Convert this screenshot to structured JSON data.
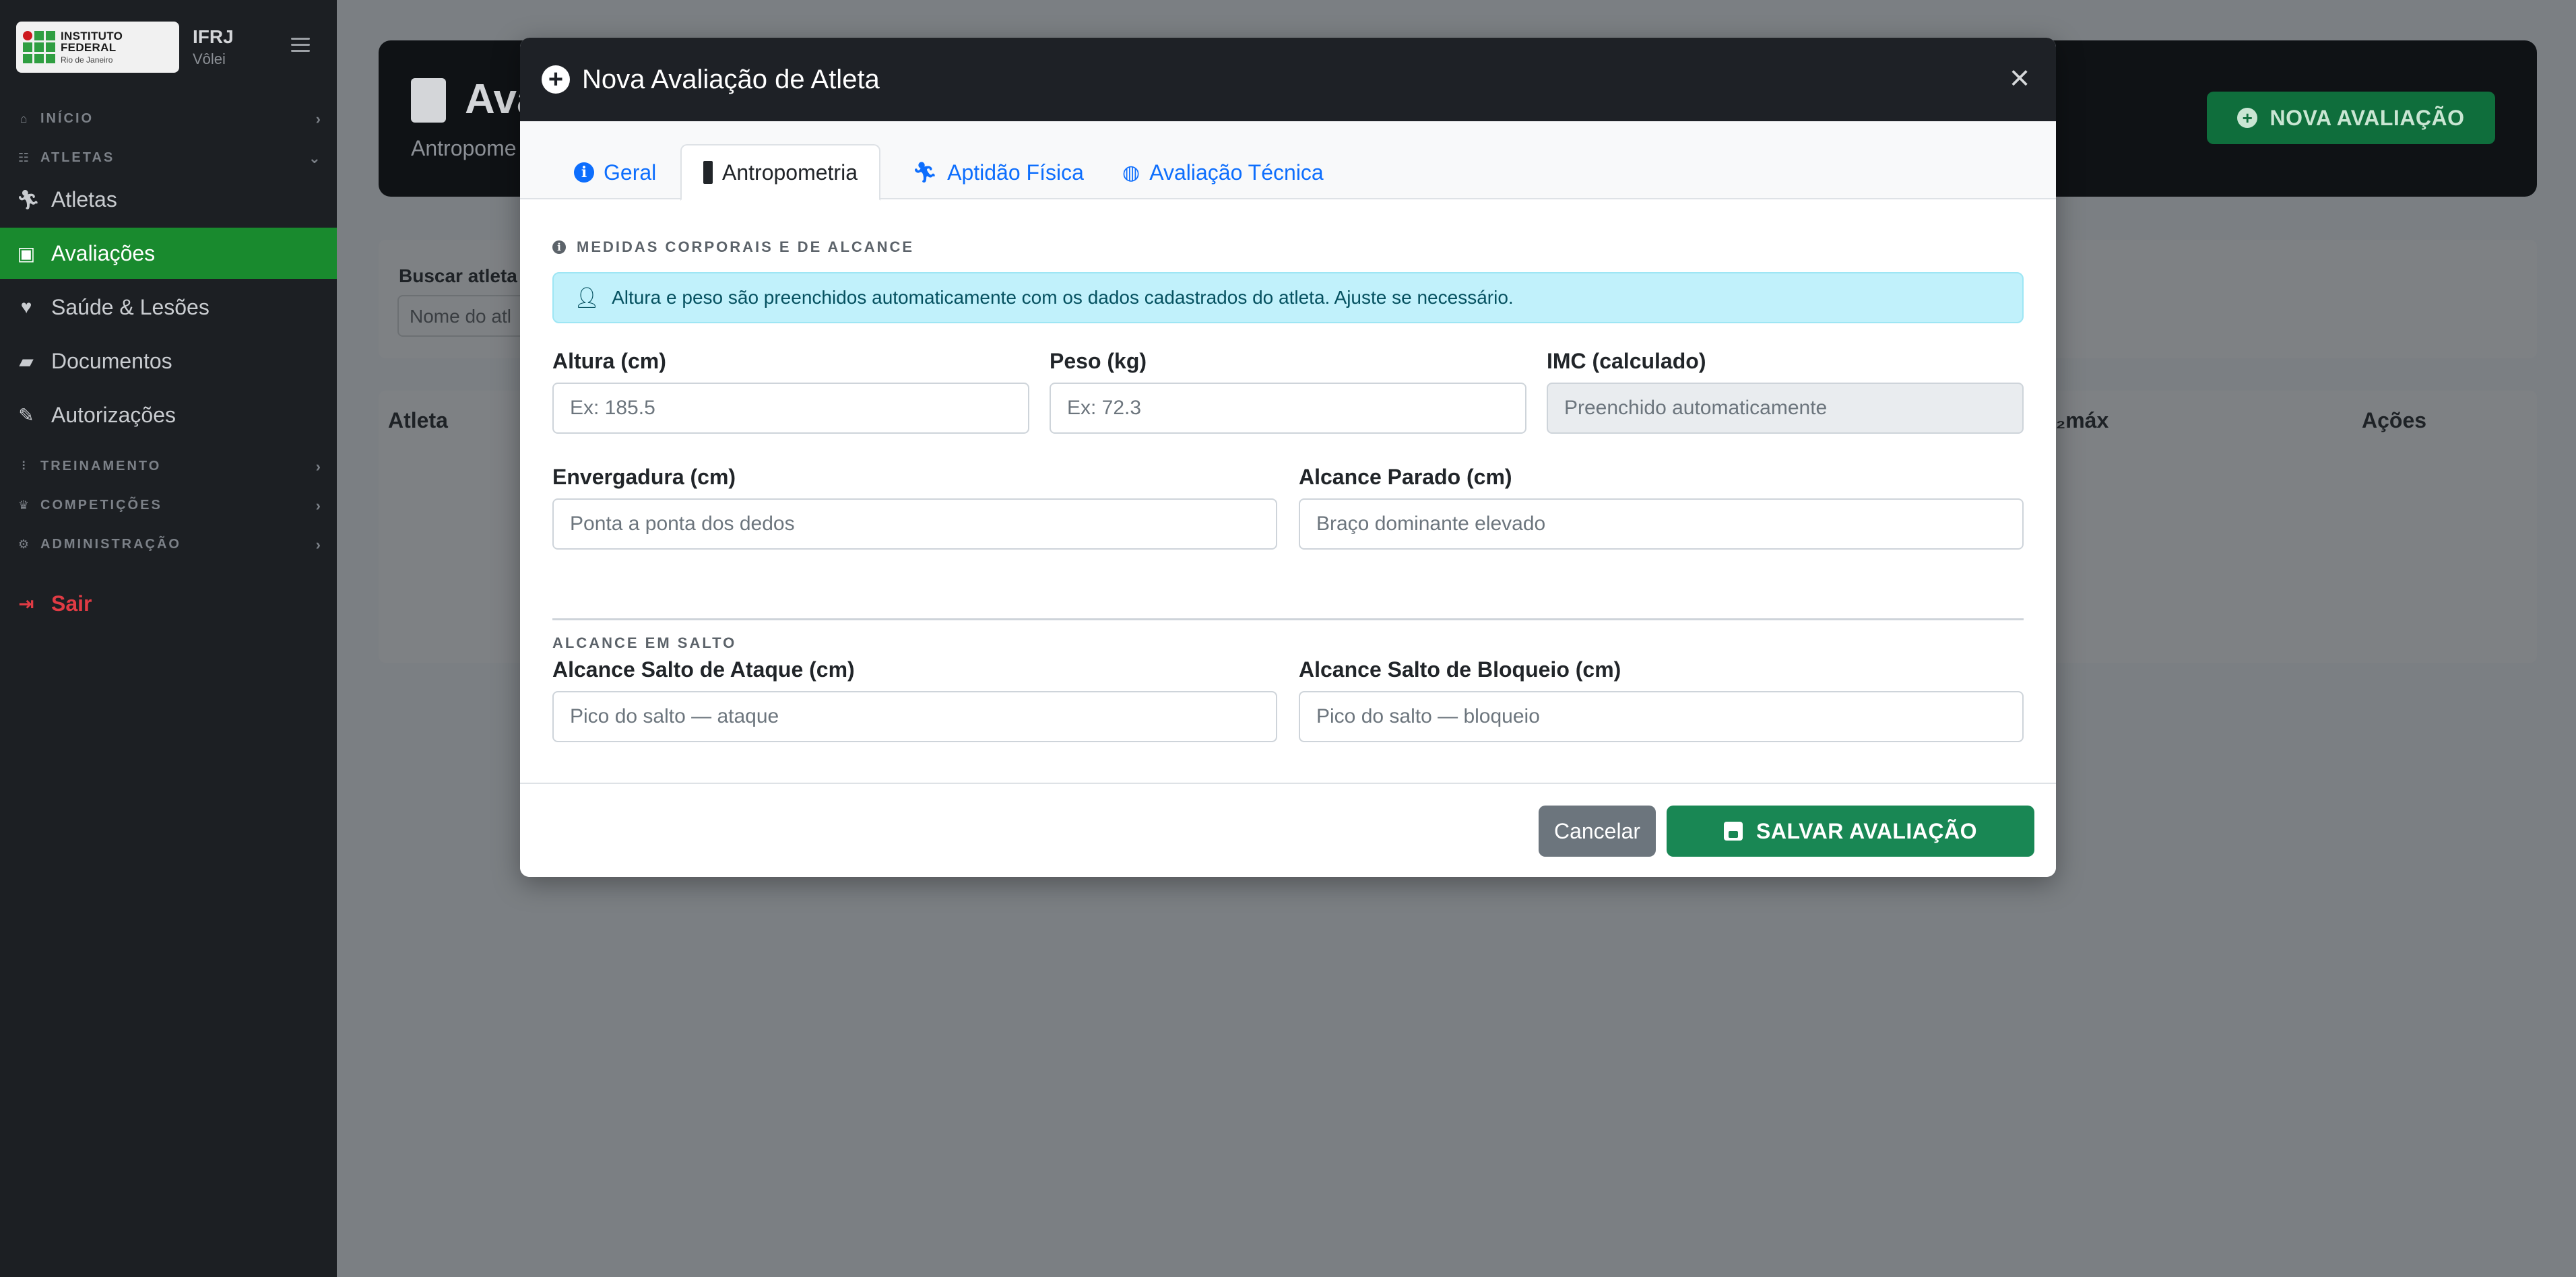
{
  "sidebar": {
    "logo_line1": "INSTITUTO FEDERAL",
    "logo_line2": "Rio de Janeiro",
    "brand_name": "IFRJ",
    "brand_sub": "Vôlei",
    "sections": {
      "inicio": "INÍCIO",
      "atletas": "ATLETAS",
      "treinamento": "TREINAMENTO",
      "competicoes": "COMPETIÇÕES",
      "administracao": "ADMINISTRAÇÃO"
    },
    "items": {
      "atletas": "Atletas",
      "avaliacoes": "Avaliações",
      "saude": "Saúde & Lesões",
      "documentos": "Documentos",
      "autorizacoes": "Autorizações",
      "sair": "Sair"
    }
  },
  "page": {
    "title": "Ava",
    "subtitle": "Antropome",
    "new_button": "NOVA AVALIAÇÃO",
    "search_label": "Buscar atleta",
    "search_placeholder": "Nome do atl",
    "table_headers": {
      "atleta": "Atleta",
      "vo2": "₂máx",
      "acoes": "Ações"
    }
  },
  "modal": {
    "title": "Nova Avaliação de Atleta",
    "close": "×",
    "tabs": {
      "geral": "Geral",
      "antropometria": "Antropometria",
      "aptidao": "Aptidão Física",
      "tecnica": "Avaliação Técnica"
    },
    "section_title": "MEDIDAS CORPORAIS E DE ALCANCE",
    "alert_text": "Altura e peso são preenchidos automaticamente com os dados cadastrados do atleta. Ajuste se necessário.",
    "fields": {
      "altura": {
        "label": "Altura (cm)",
        "placeholder": "Ex: 185.5"
      },
      "peso": {
        "label": "Peso (kg)",
        "placeholder": "Ex: 72.3"
      },
      "imc": {
        "label": "IMC (calculado)",
        "placeholder": "Preenchido automaticamente"
      },
      "envergadura": {
        "label": "Envergadura (cm)",
        "placeholder": "Ponta a ponta dos dedos"
      },
      "alcance_parado": {
        "label": "Alcance Parado (cm)",
        "placeholder": "Braço dominante elevado"
      },
      "alcance_ataque": {
        "label": "Alcance Salto de Ataque (cm)",
        "placeholder": "Pico do salto — ataque"
      },
      "alcance_bloqueio": {
        "label": "Alcance Salto de Bloqueio (cm)",
        "placeholder": "Pico do salto — bloqueio"
      }
    },
    "subsection_title": "ALCANCE EM SALTO",
    "cancel_label": "Cancelar",
    "save_label": "SALVAR AVALIAÇÃO"
  },
  "colors": {
    "sidebar_bg": "#1c1f23",
    "active_green": "#198a2e",
    "save_green": "#198754",
    "link_blue": "#0d6efd",
    "alert_bg": "#c1f1fb",
    "logout_red": "#e03b44"
  },
  "icons": {
    "home": "home-icon",
    "users": "users-icon",
    "runner": "runner-icon",
    "clipboard": "clipboard-check-icon",
    "heart": "heartbeat-icon",
    "folder": "folder-open-icon",
    "signature": "signature-icon",
    "dumbbell": "dumbbell-icon",
    "trophy": "trophy-icon",
    "gear": "gear-icon",
    "logout": "sign-out-icon"
  }
}
